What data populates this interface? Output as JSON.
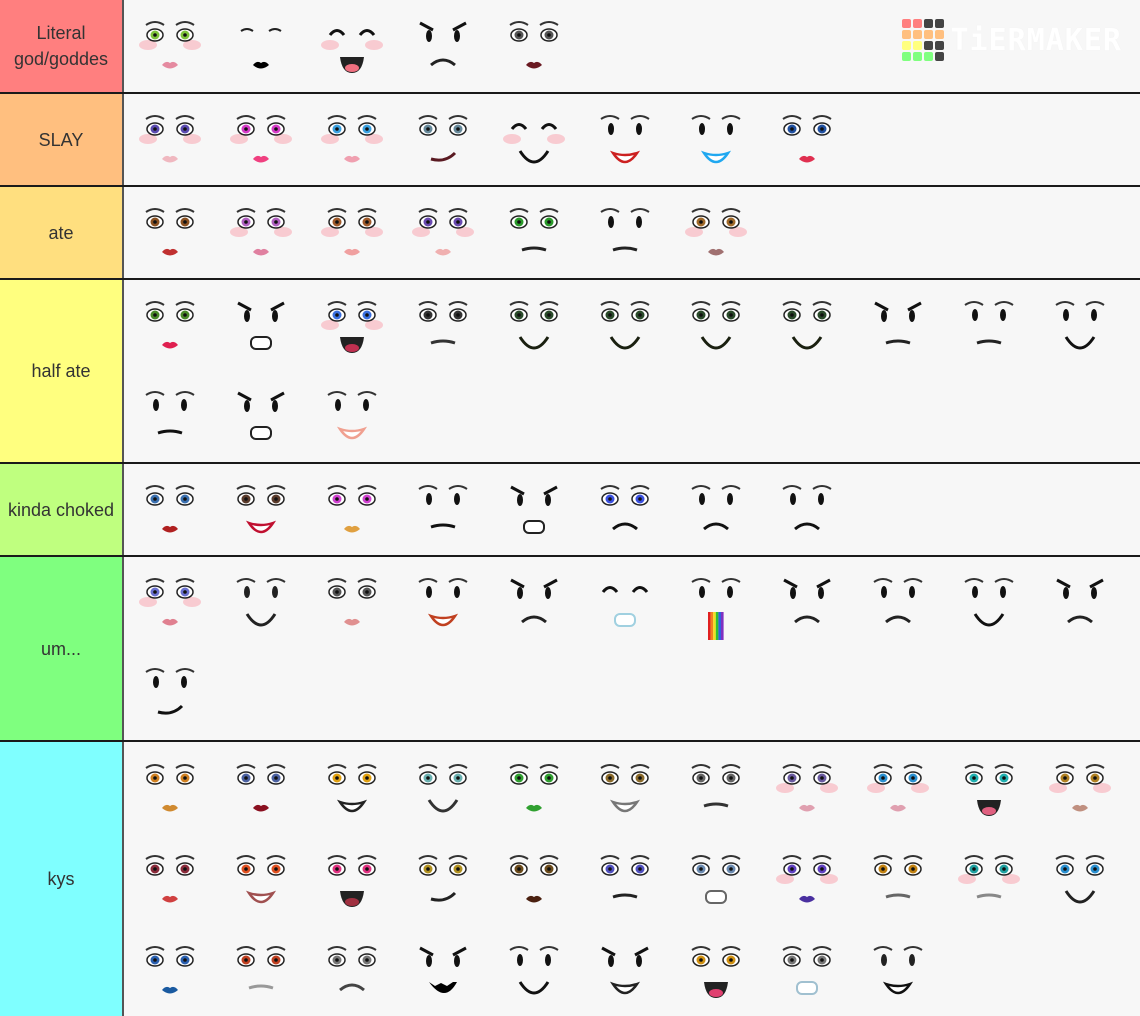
{
  "watermark": {
    "text": "TiERMAKER",
    "grid_colors": [
      "#ff7f7f",
      "#ff7f7f",
      "#444444",
      "#444444",
      "#ffbf7f",
      "#ffbf7f",
      "#ffbf7f",
      "#ffbf7f",
      "#ffff7f",
      "#ffff7f",
      "#444444",
      "#444444",
      "#7fff7f",
      "#7fff7f",
      "#7fff7f",
      "#444444"
    ]
  },
  "tiers": [
    {
      "label": "Literal god/goddes",
      "color": "#ff7f7f",
      "faces": [
        {
          "name": "green-eyed-freckle-face",
          "eye": "#7ec43a",
          "lip": "#e58aa0",
          "style": "realistic",
          "blush": true
        },
        {
          "name": "closed-lash-black-lips",
          "eye": "closed",
          "lip": "#000000",
          "style": "lips"
        },
        {
          "name": "happy-blush-open-smile",
          "eye": "happy",
          "lip": "#f07080",
          "style": "open",
          "blush": true
        },
        {
          "name": "angry-tongue-out",
          "eye": "angry",
          "lip": "#222222",
          "style": "frown"
        },
        {
          "name": "dark-lipstick-lashes",
          "eye": "#555555",
          "lip": "#6a1a22",
          "style": "realistic"
        }
      ]
    },
    {
      "label": "SLAY",
      "color": "#ffbf7f",
      "faces": [
        {
          "name": "anime-wink",
          "eye": "#5a4ab0",
          "lip": "#f0b8c0",
          "style": "realistic",
          "blush": true
        },
        {
          "name": "pink-anime-bandaid",
          "eye": "#d63ac8",
          "lip": "#f04080",
          "style": "lips",
          "blush": true
        },
        {
          "name": "blue-eyes-blush",
          "eye": "#3aa0e0",
          "lip": "#f0a0b0",
          "style": "realistic",
          "blush": true
        },
        {
          "name": "smirk-dark-lips",
          "eye": "#668899",
          "lip": "#5a1a22",
          "style": "smirk"
        },
        {
          "name": "happy-closed-blush",
          "eye": "happy",
          "lip": "#111111",
          "style": "smile",
          "blush": true
        },
        {
          "name": "red-lip-smile",
          "eye": "#111111",
          "lip": "#cc2020",
          "style": "grin"
        },
        {
          "name": "blue-sparkle-smile",
          "eye": "#111111",
          "lip": "#20a8f0",
          "style": "grin"
        },
        {
          "name": "blue-eyes-kiss",
          "eye": "#2050a0",
          "lip": "#e03050",
          "style": "lips"
        }
      ]
    },
    {
      "label": "ate",
      "color": "#ffdf7f",
      "faces": [
        {
          "name": "brown-eyes-red-lips",
          "eye": "#8a5020",
          "lip": "#c03030",
          "style": "lips"
        },
        {
          "name": "pink-lash-blush",
          "eye": "#b060c0",
          "lip": "#e080a0",
          "style": "realistic",
          "blush": true
        },
        {
          "name": "brown-anime-sprinkles",
          "eye": "#a05a2a",
          "lip": "#f0a0a0",
          "style": "realistic",
          "blush": true
        },
        {
          "name": "purple-anime-freckles",
          "eye": "#6a4ab0",
          "lip": "#f0b0b0",
          "style": "realistic",
          "blush": true
        },
        {
          "name": "green-eyes-flat",
          "eye": "#2a9a2a",
          "lip": "#222222",
          "style": "flat"
        },
        {
          "name": "red-x-flat",
          "eye": "#111111",
          "lip": "#222222",
          "style": "flat"
        },
        {
          "name": "amber-eyes-mauve-lips",
          "eye": "#a06a2a",
          "lip": "#a07070",
          "style": "lips",
          "blush": true
        }
      ]
    },
    {
      "label": "half ate",
      "color": "#ffff7f",
      "faces": [
        {
          "name": "green-eyes-red-lips",
          "eye": "#4a8a2a",
          "lip": "#e02050",
          "style": "lips"
        },
        {
          "name": "angry-open-mouth",
          "eye": "angry",
          "lip": "#222222",
          "style": "box"
        },
        {
          "name": "blue-anime-open",
          "eye": "#3a70e0",
          "lip": "#c03050",
          "style": "open",
          "blush": true
        },
        {
          "name": "gothic-tears",
          "eye": "#333333",
          "lip": "#333333",
          "style": "flat"
        },
        {
          "name": "green-smile-1",
          "eye": "#2a4a2a",
          "lip": "#1a2010",
          "style": "smile"
        },
        {
          "name": "green-smile-2",
          "eye": "#2a4a2a",
          "lip": "#1a2010",
          "style": "smile"
        },
        {
          "name": "green-smile-3",
          "eye": "#2a4a2a",
          "lip": "#1a2010",
          "style": "smile"
        },
        {
          "name": "green-smile-4",
          "eye": "#2a4a2a",
          "lip": "#1a2010",
          "style": "smile"
        },
        {
          "name": "angry-stubble",
          "eye": "angry",
          "lip": "#222222",
          "style": "flat"
        },
        {
          "name": "x-scar-flat",
          "eye": "#111111",
          "lip": "#222222",
          "style": "flat"
        },
        {
          "name": "square-eyes-smile",
          "eye": "#111111",
          "lip": "#111111",
          "style": "smile"
        },
        {
          "name": "square-eyes-smirk",
          "eye": "#111111",
          "lip": "#111111",
          "style": "flat"
        },
        {
          "name": "angry-sparks-grimace",
          "eye": "angry",
          "lip": "#222222",
          "style": "box"
        },
        {
          "name": "simple-grin",
          "eye": "#111111",
          "lip": "#f0a090",
          "style": "grin"
        }
      ]
    },
    {
      "label": "kinda choked",
      "color": "#bfff7f",
      "faces": [
        {
          "name": "blue-eyes-tears",
          "eye": "#3a70b0",
          "lip": "#b02020",
          "style": "lips"
        },
        {
          "name": "red-lip-grin",
          "eye": "#5a3a2a",
          "lip": "#c01030",
          "style": "grin"
        },
        {
          "name": "rainbow-anime",
          "eye": "#d040d0",
          "lip": "#e0a040",
          "style": "lips"
        },
        {
          "name": "mustache-frown",
          "eye": "#111111",
          "lip": "#111111",
          "style": "flat"
        },
        {
          "name": "spark-grimace",
          "eye": "angry",
          "lip": "#222222",
          "style": "box"
        },
        {
          "name": "blue-worried",
          "eye": "#3a50e0",
          "lip": "#111111",
          "style": "frown"
        },
        {
          "name": "scowl-open",
          "eye": "#111111",
          "lip": "#111111",
          "style": "frown"
        },
        {
          "name": "worried-frown",
          "eye": "#111111",
          "lip": "#111111",
          "style": "frown"
        }
      ]
    },
    {
      "label": "um...",
      "color": "#7fff7f",
      "faces": [
        {
          "name": "lavender-eyes-pink-lips",
          "eye": "#6a70d0",
          "lip": "#e08090",
          "style": "lips",
          "blush": true
        },
        {
          "name": "button-eyes-stitched",
          "eye": "#222222",
          "lip": "#222222",
          "style": "smile"
        },
        {
          "name": "gray-eyes-pink-smile",
          "eye": "#555555",
          "lip": "#e09090",
          "style": "lips"
        },
        {
          "name": "oval-eyes-open-smile",
          "eye": "#111111",
          "lip": "#c04020",
          "style": "grin"
        },
        {
          "name": "angry-smirk",
          "eye": "angry",
          "lip": "#222222",
          "style": "frown"
        },
        {
          "name": "happy-braces",
          "eye": "happy",
          "lip": "#a0d0e0",
          "style": "box"
        },
        {
          "name": "rainbow-puke",
          "eye": "#111111",
          "lip": "#ff0000",
          "style": "rainbow"
        },
        {
          "name": "angry-lopsided",
          "eye": "angry",
          "lip": "#222222",
          "style": "frown"
        },
        {
          "name": "worried-lopsided",
          "eye": "#111111",
          "lip": "#222222",
          "style": "frown"
        },
        {
          "name": "raised-brow-smile",
          "eye": "#111111",
          "lip": "#111111",
          "style": "smile"
        },
        {
          "name": "angry-frown",
          "eye": "angry",
          "lip": "#222222",
          "style": "frown"
        },
        {
          "name": "smirk-simple",
          "eye": "#111111",
          "lip": "#111111",
          "style": "smirk"
        }
      ]
    },
    {
      "label": "kys",
      "color": "#7fffff",
      "faces": [
        {
          "name": "orange-tattoo-face",
          "eye": "#d08020",
          "lip": "#d08a30",
          "style": "lips"
        },
        {
          "name": "blue-eyes-wine-lips",
          "eye": "#4a60a0",
          "lip": "#8a1020",
          "style": "lips"
        },
        {
          "name": "gold-star-grin",
          "eye": "#e0a010",
          "lip": "#222222",
          "style": "grin"
        },
        {
          "name": "teal-eyes-smile",
          "eye": "#6ab0b0",
          "lip": "#333333",
          "style": "smile"
        },
        {
          "name": "green-tattoo-face",
          "eye": "#30a030",
          "lip": "#30a030",
          "style": "lips"
        },
        {
          "name": "brown-eyes-teeth",
          "eye": "#8a6a2a",
          "lip": "#777777",
          "style": "grin"
        },
        {
          "name": "sketch-wink",
          "eye": "#666666",
          "lip": "#333333",
          "style": "flat"
        },
        {
          "name": "purple-eyes-smile",
          "eye": "#6a5aa0",
          "lip": "#e0a0b0",
          "style": "lips",
          "blush": true
        },
        {
          "name": "blue-shadow-wink",
          "eye": "#2a90d0",
          "lip": "#e0a0b0",
          "style": "lips",
          "blush": true
        },
        {
          "name": "teal-anime-frost",
          "eye": "#20b0b0",
          "lip": "#e06080",
          "style": "open"
        },
        {
          "name": "gold-eyes-bronze",
          "eye": "#b08020",
          "lip": "#c09080",
          "style": "lips",
          "blush": true
        },
        {
          "name": "red-eyes-pale",
          "eye": "#8a2a3a",
          "lip": "#d04040",
          "style": "lips"
        },
        {
          "name": "orange-eyes-smirk",
          "eye": "#e05020",
          "lip": "#a05050",
          "style": "grin"
        },
        {
          "name": "pink-eyes-blue-nose-fangs",
          "eye": "#e03080",
          "lip": "#a03040",
          "style": "open"
        },
        {
          "name": "gold-eyes-cat-smirk",
          "eye": "#b09020",
          "lip": "#222222",
          "style": "smirk"
        },
        {
          "name": "brown-eyes-dark-lips",
          "eye": "#6a4a1a",
          "lip": "#4a2010",
          "style": "lips"
        },
        {
          "name": "purple-eye-wink",
          "eye": "#5050c0",
          "lip": "#222222",
          "style": "flat"
        },
        {
          "name": "gray-eyes-chin",
          "eye": "#6a8ab0",
          "lip": "#666666",
          "style": "box"
        },
        {
          "name": "heterochromia-purple-lips",
          "eye": "#6040c0",
          "lip": "#4a30a0",
          "style": "lips",
          "blush": true
        },
        {
          "name": "amber-eyes-freckles",
          "eye": "#c08010",
          "lip": "#666666",
          "style": "flat"
        },
        {
          "name": "teal-angry-blush",
          "eye": "#20a0a0",
          "lip": "#888888",
          "style": "flat",
          "blush": true
        },
        {
          "name": "blue-lashes-smile",
          "eye": "#2a90d0",
          "lip": "#222222",
          "style": "smile"
        },
        {
          "name": "blue-tattoo-face",
          "eye": "#2a60b0",
          "lip": "#1a5aa0",
          "style": "lips"
        },
        {
          "name": "red-tattoo-face",
          "eye": "#c04020",
          "lip": "#999999",
          "style": "flat"
        },
        {
          "name": "sketch-frown",
          "eye": "#777777",
          "lip": "#444444",
          "style": "frown"
        },
        {
          "name": "angry-fang-grin",
          "eye": "angry",
          "lip": "#000000",
          "style": "fangs"
        },
        {
          "name": "simple-smirk-eyes",
          "eye": "#111111",
          "lip": "#111111",
          "style": "smile"
        },
        {
          "name": "angry-white-grin",
          "eye": "angry",
          "lip": "#222222",
          "style": "grin"
        },
        {
          "name": "gold-eyes-open-smile",
          "eye": "#d09010",
          "lip": "#e04070",
          "style": "open"
        },
        {
          "name": "sleepy-braces",
          "eye": "#777777",
          "lip": "#a0c0d0",
          "style": "box"
        },
        {
          "name": "googly-big-grin",
          "eye": "#222222",
          "lip": "#111111",
          "style": "grin"
        }
      ]
    }
  ]
}
